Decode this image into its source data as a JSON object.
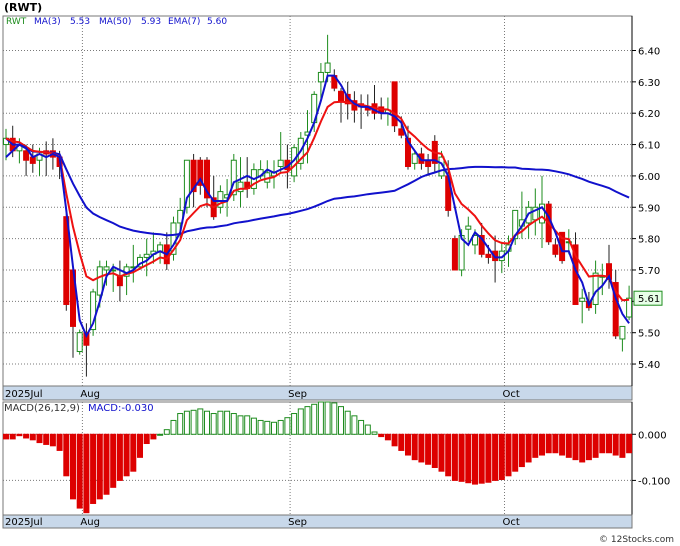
{
  "chart_data": [
    {
      "type": "candlestick",
      "ticker_label": "(RWT)",
      "legend": [
        {
          "label": "RWT",
          "color": "#1e8c1e"
        },
        {
          "label": "MA(3)",
          "color": "#1111cc"
        },
        {
          "label": "5.53",
          "color": "#1111cc"
        },
        {
          "label": "MA(50)",
          "color": "#1111cc"
        },
        {
          "label": "5.93",
          "color": "#1111cc"
        },
        {
          "label": "EMA(7)",
          "color": "#1111cc"
        },
        {
          "label": "5.60",
          "color": "#1111cc"
        }
      ],
      "ylim": [
        5.33,
        6.51
      ],
      "y_ticks": [
        "5.40",
        "5.50",
        "5.60",
        "5.70",
        "5.80",
        "5.90",
        "6.00",
        "6.10",
        "6.20",
        "6.30",
        "6.40"
      ],
      "x_labels": [
        {
          "label": "2025Jul",
          "index": 0
        },
        {
          "label": "Aug",
          "index": 12
        },
        {
          "label": "Sep",
          "index": 43
        },
        {
          "label": "Oct",
          "index": 75
        }
      ],
      "last_price_label": "5.61",
      "colors": {
        "up": "#1e8c1e",
        "down": "#dd0000",
        "ma3": "#1111cc",
        "ma50": "#1111cc",
        "ema7": "#ee1111",
        "grid": "#7a7a7a",
        "axis_bar": "#c8d8ea"
      },
      "candles": [
        [
          6.1,
          6.15,
          6.05,
          6.12
        ],
        [
          6.12,
          6.16,
          6.06,
          6.08
        ],
        [
          6.08,
          6.12,
          6.04,
          6.1
        ],
        [
          6.08,
          6.1,
          6.0,
          6.05
        ],
        [
          6.06,
          6.1,
          6.01,
          6.04
        ],
        [
          6.05,
          6.09,
          6.0,
          6.07
        ],
        [
          6.08,
          6.11,
          6.0,
          6.07
        ],
        [
          6.08,
          6.12,
          6.02,
          6.06
        ],
        [
          6.06,
          6.08,
          5.99,
          6.03
        ],
        [
          5.87,
          5.88,
          5.57,
          5.59
        ],
        [
          5.7,
          5.72,
          5.42,
          5.52
        ],
        [
          5.44,
          5.51,
          5.43,
          5.5
        ],
        [
          5.5,
          5.53,
          5.36,
          5.46
        ],
        [
          5.51,
          5.64,
          5.49,
          5.63
        ],
        [
          5.62,
          5.73,
          5.58,
          5.71
        ],
        [
          5.7,
          5.73,
          5.65,
          5.71
        ],
        [
          5.7,
          5.72,
          5.63,
          5.7
        ],
        [
          5.68,
          5.73,
          5.6,
          5.65
        ],
        [
          5.68,
          5.72,
          5.62,
          5.71
        ],
        [
          5.71,
          5.78,
          5.66,
          5.71
        ],
        [
          5.71,
          5.75,
          5.7,
          5.74
        ],
        [
          5.74,
          5.8,
          5.68,
          5.75
        ],
        [
          5.75,
          5.82,
          5.72,
          5.76
        ],
        [
          5.76,
          5.79,
          5.72,
          5.78
        ],
        [
          5.78,
          5.82,
          5.7,
          5.72
        ],
        [
          5.75,
          5.87,
          5.73,
          5.85
        ],
        [
          5.85,
          5.93,
          5.8,
          5.89
        ],
        [
          5.9,
          6.05,
          5.88,
          6.05
        ],
        [
          6.05,
          6.07,
          5.9,
          5.95
        ],
        [
          6.05,
          6.06,
          5.94,
          5.97
        ],
        [
          6.05,
          6.06,
          5.9,
          5.93
        ],
        [
          5.93,
          6.0,
          5.86,
          5.87
        ],
        [
          5.9,
          5.97,
          5.88,
          5.95
        ],
        [
          5.93,
          5.99,
          5.87,
          5.94
        ],
        [
          5.94,
          6.07,
          5.92,
          6.05
        ],
        [
          5.95,
          6.06,
          5.9,
          5.98
        ],
        [
          5.98,
          6.06,
          5.93,
          5.96
        ],
        [
          5.96,
          6.04,
          5.94,
          6.02
        ],
        [
          6.0,
          6.05,
          5.99,
          6.02
        ],
        [
          5.98,
          6.05,
          5.96,
          6.01
        ],
        [
          6.0,
          6.05,
          5.96,
          6.01
        ],
        [
          6.03,
          6.14,
          6.01,
          6.05
        ],
        [
          6.05,
          6.1,
          5.96,
          6.02
        ],
        [
          6.0,
          6.1,
          5.98,
          6.09
        ],
        [
          6.04,
          6.14,
          6.02,
          6.12
        ],
        [
          6.13,
          6.21,
          6.04,
          6.14
        ],
        [
          6.17,
          6.27,
          6.14,
          6.26
        ],
        [
          6.3,
          6.36,
          6.24,
          6.33
        ],
        [
          6.33,
          6.45,
          6.3,
          6.36
        ],
        [
          6.32,
          6.34,
          6.27,
          6.28
        ],
        [
          6.27,
          6.28,
          6.17,
          6.24
        ],
        [
          6.26,
          6.3,
          6.18,
          6.23
        ],
        [
          6.24,
          6.27,
          6.17,
          6.21
        ],
        [
          6.23,
          6.26,
          6.15,
          6.22
        ],
        [
          6.22,
          6.26,
          6.19,
          6.21
        ],
        [
          6.23,
          6.29,
          6.18,
          6.2
        ],
        [
          6.22,
          6.25,
          6.18,
          6.2
        ],
        [
          6.2,
          6.25,
          6.16,
          6.21
        ],
        [
          6.3,
          6.3,
          6.14,
          6.16
        ],
        [
          6.15,
          6.19,
          6.12,
          6.13
        ],
        [
          6.12,
          6.16,
          6.02,
          6.03
        ],
        [
          6.04,
          6.08,
          6.02,
          6.07
        ],
        [
          6.07,
          6.09,
          6.02,
          6.04
        ],
        [
          6.05,
          6.07,
          6.0,
          6.03
        ],
        [
          6.11,
          6.13,
          6.01,
          6.04
        ],
        [
          6.0,
          6.08,
          5.99,
          6.06
        ],
        [
          6.0,
          6.05,
          5.87,
          5.89
        ],
        [
          5.8,
          5.81,
          5.7,
          5.7
        ],
        [
          5.7,
          5.83,
          5.68,
          5.81
        ],
        [
          5.83,
          5.87,
          5.79,
          5.84
        ],
        [
          5.78,
          5.83,
          5.75,
          5.81
        ],
        [
          5.81,
          5.85,
          5.74,
          5.75
        ],
        [
          5.75,
          5.78,
          5.72,
          5.74
        ],
        [
          5.76,
          5.81,
          5.66,
          5.73
        ],
        [
          5.73,
          5.79,
          5.69,
          5.76
        ],
        [
          5.76,
          5.81,
          5.71,
          5.78
        ],
        [
          5.8,
          5.87,
          5.78,
          5.89
        ],
        [
          5.84,
          5.95,
          5.8,
          5.86
        ],
        [
          5.85,
          5.92,
          5.8,
          5.9
        ],
        [
          5.86,
          5.96,
          5.81,
          5.9
        ],
        [
          5.85,
          6.0,
          5.77,
          5.91
        ],
        [
          5.91,
          5.92,
          5.78,
          5.79
        ],
        [
          5.78,
          5.8,
          5.74,
          5.75
        ],
        [
          5.82,
          5.82,
          5.72,
          5.73
        ],
        [
          5.79,
          5.83,
          5.75,
          5.79
        ],
        [
          5.78,
          5.82,
          5.6,
          5.59
        ],
        [
          5.6,
          5.64,
          5.53,
          5.61
        ],
        [
          5.6,
          5.63,
          5.57,
          5.58
        ],
        [
          5.59,
          5.73,
          5.56,
          5.69
        ],
        [
          5.68,
          5.72,
          5.62,
          5.68
        ],
        [
          5.72,
          5.78,
          5.64,
          5.67
        ],
        [
          5.66,
          5.7,
          5.48,
          5.49
        ],
        [
          5.48,
          5.51,
          5.44,
          5.52
        ],
        [
          5.55,
          5.65,
          5.54,
          5.61
        ]
      ],
      "ma3": [
        6.06,
        6.08,
        6.1,
        6.09,
        6.06,
        6.07,
        6.06,
        6.07,
        6.06,
        5.89,
        5.71,
        5.54,
        5.49,
        5.53,
        5.6,
        5.68,
        5.71,
        5.7,
        5.69,
        5.7,
        5.72,
        5.73,
        5.75,
        5.76,
        5.75,
        5.78,
        5.82,
        5.93,
        5.96,
        5.99,
        5.95,
        5.92,
        5.92,
        5.92,
        5.98,
        5.99,
        6.0,
        5.99,
        6.0,
        6.02,
        6.01,
        6.02,
        6.03,
        6.05,
        6.08,
        6.12,
        6.17,
        6.24,
        6.32,
        6.32,
        6.29,
        6.25,
        6.23,
        6.22,
        6.22,
        6.21,
        6.2,
        6.2,
        6.19,
        6.17,
        6.11,
        6.08,
        6.05,
        6.05,
        6.05,
        6.04,
        6.0,
        5.9,
        5.8,
        5.78,
        5.82,
        5.8,
        5.77,
        5.74,
        5.74,
        5.76,
        5.81,
        5.84,
        5.88,
        5.89,
        5.9,
        5.87,
        5.82,
        5.76,
        5.76,
        5.7,
        5.66,
        5.59,
        5.63,
        5.65,
        5.68,
        5.61,
        5.56,
        5.53
      ]
    },
    {
      "type": "bar",
      "title_label": "MACD(26,12,9)",
      "value_label": "MACD:-0.030",
      "ylim": [
        -0.175,
        0.07
      ],
      "y_ticks": [
        "0.000",
        "-0.100"
      ],
      "x_labels": [
        {
          "label": "2025Jul",
          "index": 0
        },
        {
          "label": "Aug",
          "index": 12
        },
        {
          "label": "Sep",
          "index": 43
        },
        {
          "label": "Oct",
          "index": 75
        }
      ],
      "colors": {
        "positive": "#1e8c1e",
        "negative": "#dd0000",
        "grid": "#7a7a7a"
      },
      "values": [
        -0.01,
        -0.01,
        -0.003,
        -0.008,
        -0.012,
        -0.018,
        -0.022,
        -0.025,
        -0.035,
        -0.09,
        -0.14,
        -0.16,
        -0.17,
        -0.15,
        -0.14,
        -0.13,
        -0.115,
        -0.1,
        -0.09,
        -0.08,
        -0.05,
        -0.02,
        -0.01,
        0.0,
        0.01,
        0.03,
        0.045,
        0.05,
        0.052,
        0.055,
        0.05,
        0.045,
        0.05,
        0.05,
        0.045,
        0.04,
        0.04,
        0.035,
        0.03,
        0.028,
        0.026,
        0.03,
        0.036,
        0.045,
        0.055,
        0.06,
        0.065,
        0.07,
        0.07,
        0.068,
        0.06,
        0.05,
        0.04,
        0.03,
        0.02,
        0.005,
        -0.005,
        -0.012,
        -0.025,
        -0.035,
        -0.045,
        -0.055,
        -0.06,
        -0.065,
        -0.072,
        -0.08,
        -0.09,
        -0.1,
        -0.102,
        -0.105,
        -0.108,
        -0.106,
        -0.104,
        -0.1,
        -0.098,
        -0.09,
        -0.08,
        -0.07,
        -0.06,
        -0.05,
        -0.045,
        -0.04,
        -0.04,
        -0.045,
        -0.05,
        -0.055,
        -0.06,
        -0.055,
        -0.05,
        -0.04,
        -0.04,
        -0.045,
        -0.05,
        -0.04
      ]
    }
  ],
  "footer": {
    "copyright": "© 12Stocks.com"
  }
}
